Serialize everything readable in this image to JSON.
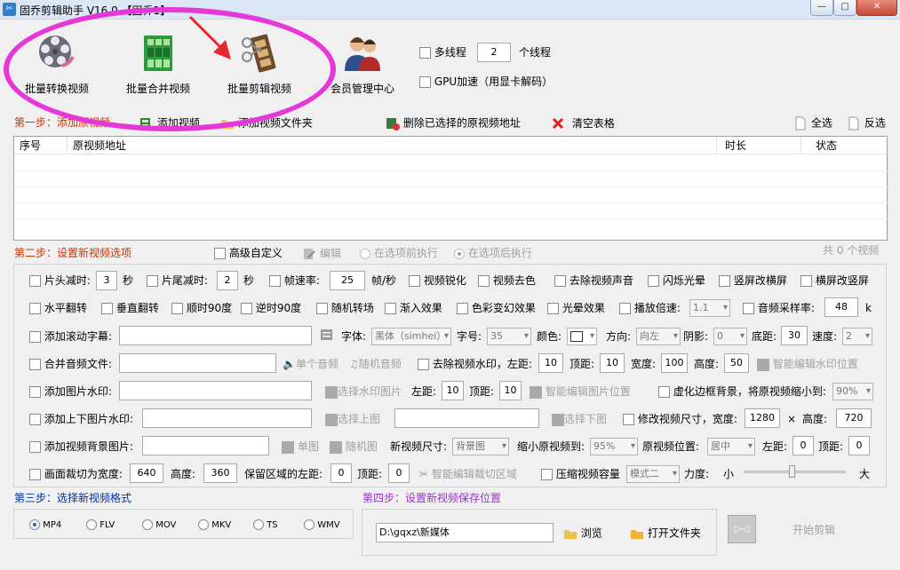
{
  "window": {
    "title": "固乔剪辑助手 V16.0 【固乔1】",
    "min_label": "—",
    "max_label": "□",
    "close_label": "✕"
  },
  "toolbar": {
    "batch_convert": "批量转换视频",
    "batch_merge": "批量合并视频",
    "batch_edit": "批量剪辑视频",
    "member_center": "会员管理中心",
    "multithread_label": "多线程",
    "thread_count": "2",
    "thread_unit": "个线程",
    "gpu_label": "GPU加速（用显卡解码）"
  },
  "step1": {
    "label": "第一步：添加原视频",
    "add_video": "添加视频",
    "add_folder": "添加视频文件夹",
    "delete_selected": "删除已选择的原视频地址",
    "clear_table": "清空表格",
    "select_all": "全选",
    "invert_select": "反选"
  },
  "table": {
    "columns": [
      "序号",
      "原视频地址",
      "时长",
      "状态"
    ]
  },
  "step2": {
    "label": "第二步：设置新视频选项",
    "advanced_custom": "高级自定义",
    "edit": "编辑",
    "before_option": "在选项前执行",
    "after_option": "在选项后执行",
    "count": "共 0 个视频"
  },
  "row1": {
    "head_cut": "片头减时:",
    "head_cut_val": "3",
    "sec1": "秒",
    "tail_cut": "片尾减时:",
    "tail_cut_val": "2",
    "sec2": "秒",
    "frame_rate": "帧速率:",
    "frame_rate_val": "25",
    "fps_unit": "帧/秒",
    "sharpen": "视频锐化",
    "decolor": "视频去色",
    "remove_audio": "去除视频声音",
    "flash_glow": "闪烁光晕",
    "v_to_h": "竖屏改横屏",
    "h_to_v": "横屏改竖屏"
  },
  "row2": {
    "h_flip": "水平翻转",
    "v_flip": "垂直翻转",
    "cw90": "顺时90度",
    "ccw90": "逆时90度",
    "random_transition": "随机转场",
    "fade_in": "渐入效果",
    "color_shift": "色彩变幻效果",
    "glow_effect": "光晕效果",
    "play_speed": "播放倍速:",
    "play_speed_val": "1.1",
    "sample_rate": "音频采样率:",
    "sample_rate_val": "48",
    "sample_unit": "k"
  },
  "row3": {
    "scroll_sub": "添加滚动字幕:",
    "font": "字体:",
    "font_val": "黑体（simhei）",
    "size": "字号:",
    "size_val": "35",
    "color": "颜色:",
    "direction": "方向:",
    "direction_val": "向左",
    "shadow": "阴影:",
    "shadow_val": "0",
    "bottom": "底距:",
    "bottom_val": "30",
    "speed": "速度:",
    "speed_val": "2"
  },
  "row4": {
    "merge_audio": "合并音频文件:",
    "single_audio": "单个音频",
    "random_audio": "随机音频",
    "remove_watermark": "去除视频水印，左距:",
    "left_val": "10",
    "top": "顶距:",
    "top_val": "10",
    "width": "宽度:",
    "width_val": "100",
    "height": "高度:",
    "height_val": "50",
    "smart_watermark": "智能编辑水印位置"
  },
  "row5": {
    "image_watermark": "添加图片水印:",
    "choose_watermark": "选择水印图片",
    "left": "左距:",
    "left_val": "10",
    "top": "顶距:",
    "top_val": "10",
    "smart_image": "智能编辑图片位置",
    "blur_border": "虚化边框背景，将原视频缩小到:",
    "blur_val": "90%"
  },
  "row6": {
    "top_bottom_image": "添加上下图片水印:",
    "choose_top": "选择上图",
    "choose_bottom": "选择下图",
    "resize": "修改视频尺寸，宽度:",
    "resize_w": "1280",
    "times": "×",
    "height": "高度:",
    "resize_h": "720"
  },
  "row7": {
    "bg_image": "添加视频背景图片:",
    "single_image": "单图",
    "random_image": "随机图",
    "new_size": "新视频尺寸:",
    "new_size_val": "背景图",
    "shrink": "缩小原视频到:",
    "shrink_val": "95%",
    "position": "原视频位置:",
    "position_val": "居中",
    "left": "左距:",
    "left_val": "0",
    "top": "顶距:",
    "top_val": "0"
  },
  "row8": {
    "crop": "画面裁切为宽度:",
    "crop_w": "640",
    "height": "高度:",
    "crop_h": "360",
    "keep_left": "保留区域的左距:",
    "keep_left_val": "0",
    "top": "顶距:",
    "top_val": "0",
    "smart_crop": "智能编辑裁切区域",
    "compress": "压缩视频容量",
    "mode_val": "模式二",
    "strength": "力度:",
    "small": "小",
    "large": "大"
  },
  "step3": {
    "label": "第三步：选择新视频格式",
    "formats": [
      "MP4",
      "FLV",
      "MOV",
      "MKV",
      "TS",
      "WMV"
    ]
  },
  "step4": {
    "label": "第四步：设置新视频保存位置",
    "path": "D:\\gqxz\\新媒体",
    "browse": "浏览",
    "open_folder": "打开文件夹",
    "start": "开始剪辑"
  },
  "colors": {
    "accent": "#1e6fc7",
    "annotation": "#e638d8",
    "step": "#cc3300"
  }
}
